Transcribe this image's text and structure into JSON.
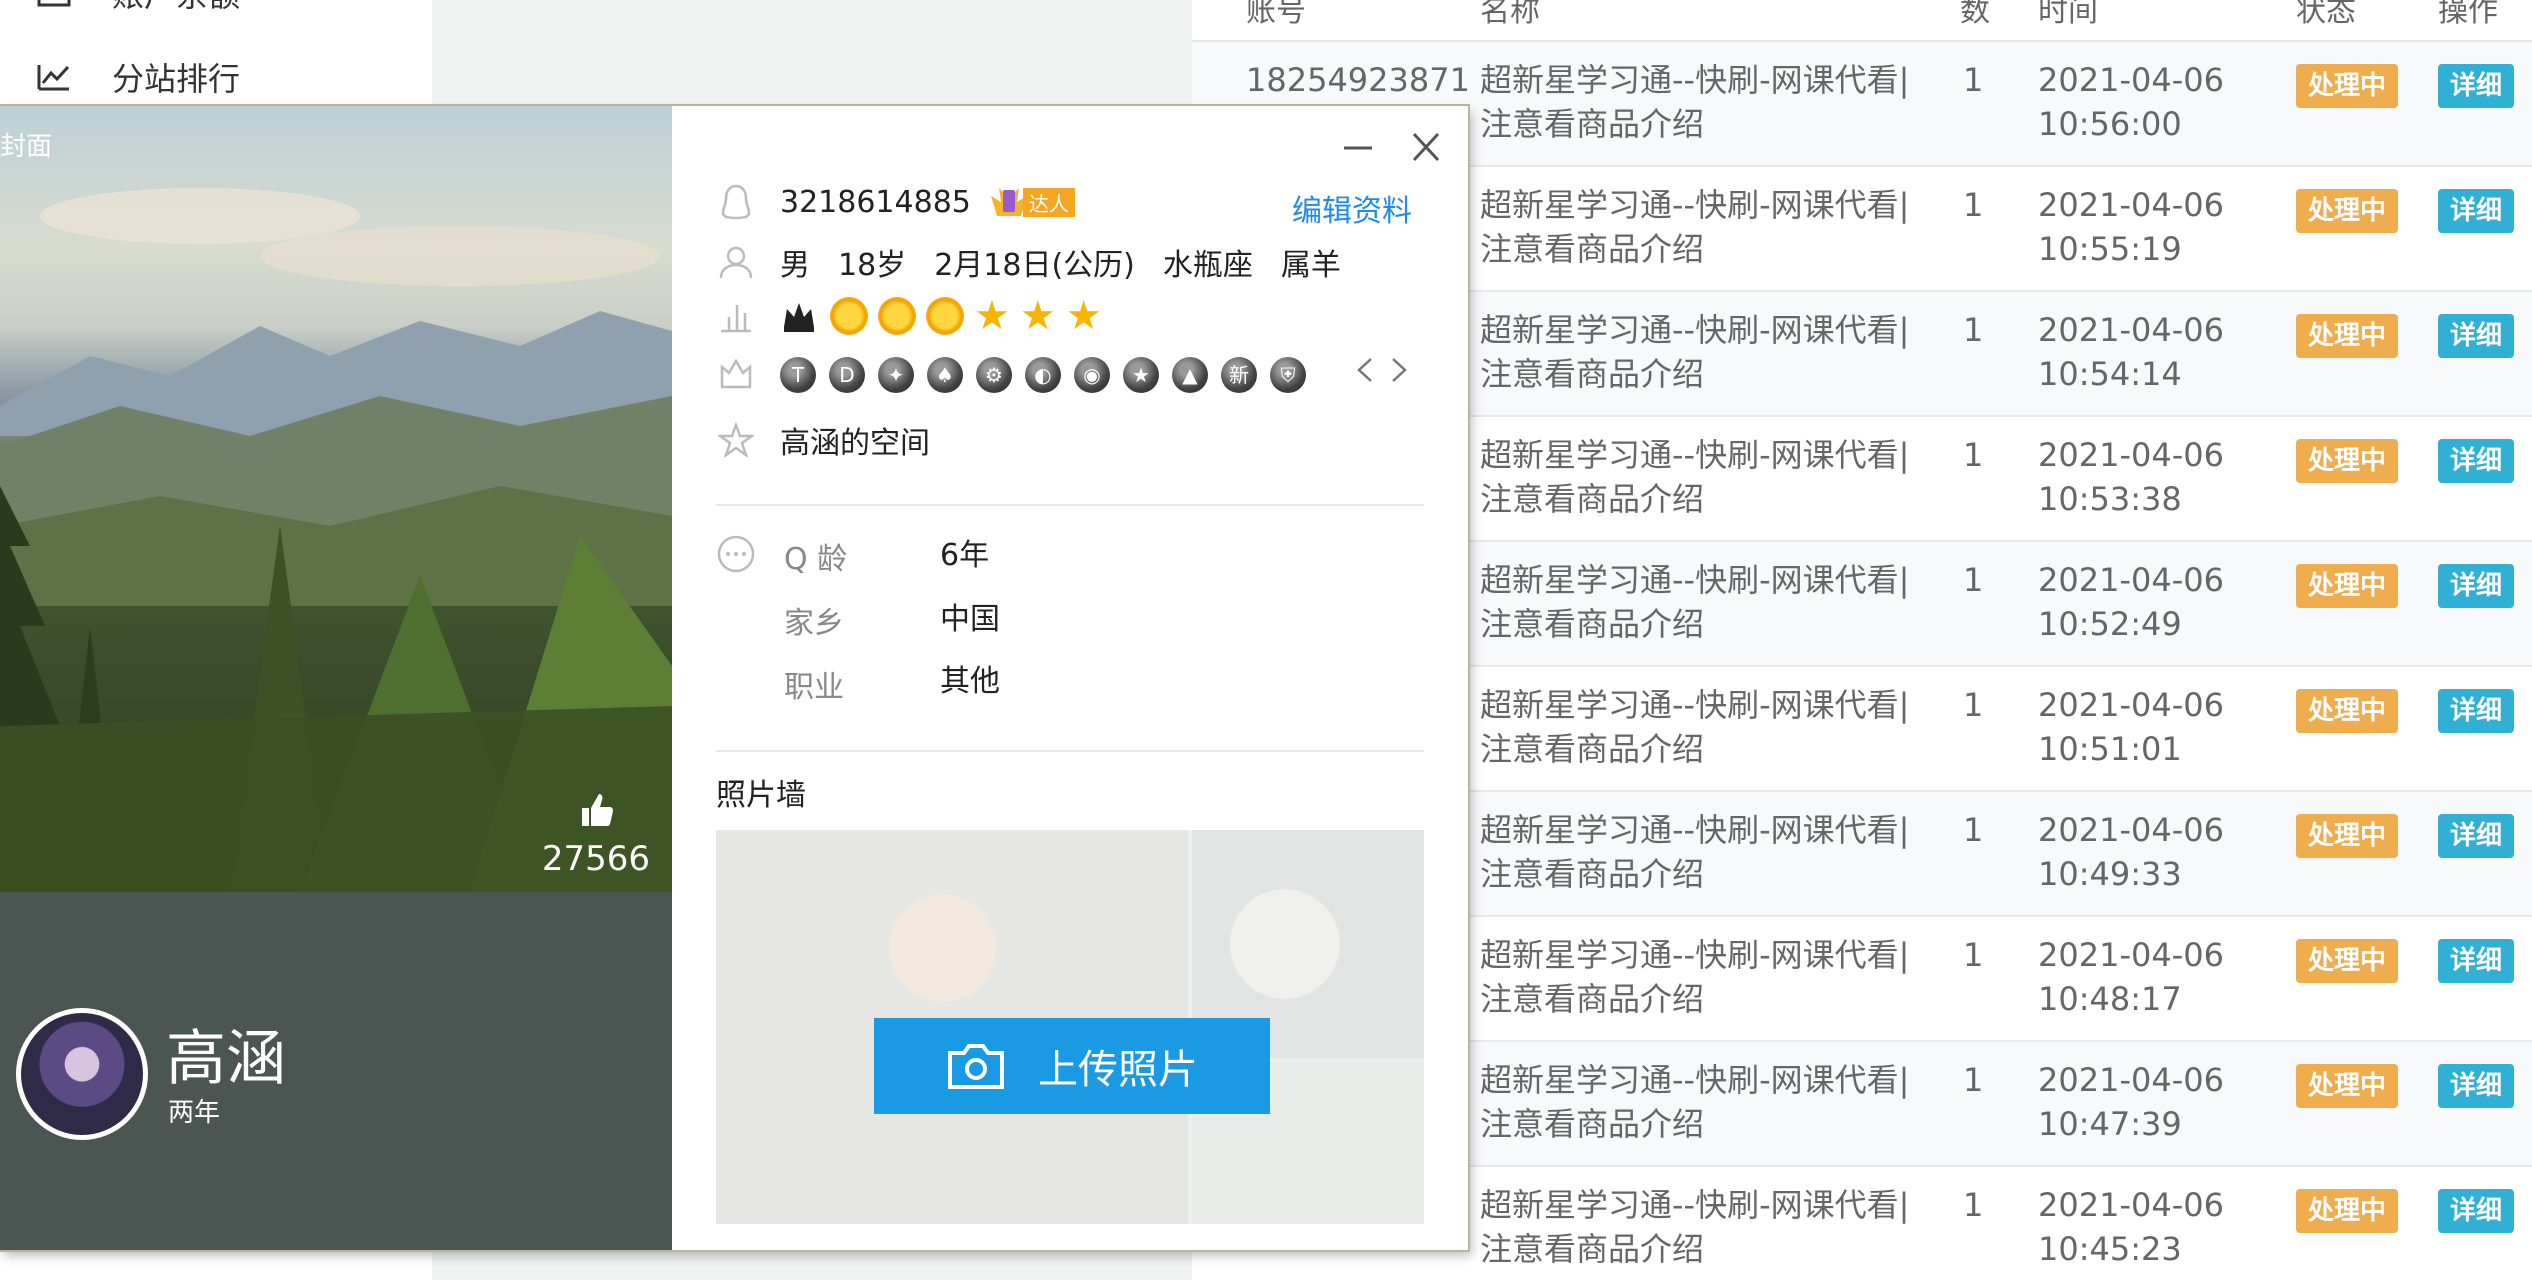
{
  "sidebar": {
    "items": [
      {
        "label": "账户余额",
        "icon": "wallet-icon"
      },
      {
        "label": "分站排行",
        "icon": "chart-line-icon"
      }
    ]
  },
  "orders_table": {
    "headers": [
      "账号",
      "名称",
      "数",
      "时间",
      "状态",
      "操作"
    ],
    "rows": [
      {
        "account": "18254923871",
        "name": "超新星学习通--快刷-网课代看|注意看商品介绍",
        "qty": "1",
        "date": "2021-04-06",
        "time": "10:56:00",
        "status": "处理中",
        "action": "详细"
      },
      {
        "account": "",
        "name": "超新星学习通--快刷-网课代看|注意看商品介绍",
        "qty": "1",
        "date": "2021-04-06",
        "time": "10:55:19",
        "status": "处理中",
        "action": "详细"
      },
      {
        "account": "",
        "name": "超新星学习通--快刷-网课代看|注意看商品介绍",
        "qty": "1",
        "date": "2021-04-06",
        "time": "10:54:14",
        "status": "处理中",
        "action": "详细"
      },
      {
        "account": "",
        "name": "超新星学习通--快刷-网课代看|注意看商品介绍",
        "qty": "1",
        "date": "2021-04-06",
        "time": "10:53:38",
        "status": "处理中",
        "action": "详细"
      },
      {
        "account": "",
        "name": "超新星学习通--快刷-网课代看|注意看商品介绍",
        "qty": "1",
        "date": "2021-04-06",
        "time": "10:52:49",
        "status": "处理中",
        "action": "详细"
      },
      {
        "account": "",
        "name": "超新星学习通--快刷-网课代看|注意看商品介绍",
        "qty": "1",
        "date": "2021-04-06",
        "time": "10:51:01",
        "status": "处理中",
        "action": "详细"
      },
      {
        "account": "",
        "name": "超新星学习通--快刷-网课代看|注意看商品介绍",
        "qty": "1",
        "date": "2021-04-06",
        "time": "10:49:33",
        "status": "处理中",
        "action": "详细"
      },
      {
        "account": "",
        "name": "超新星学习通--快刷-网课代看|注意看商品介绍",
        "qty": "1",
        "date": "2021-04-06",
        "time": "10:48:17",
        "status": "处理中",
        "action": "详细"
      },
      {
        "account": "",
        "name": "超新星学习通--快刷-网课代看|注意看商品介绍",
        "qty": "1",
        "date": "2021-04-06",
        "time": "10:47:39",
        "status": "处理中",
        "action": "详细"
      },
      {
        "account": "",
        "name": "超新星学习通--快刷-网课代看|注意看商品介绍",
        "qty": "1",
        "date": "2021-04-06",
        "time": "10:45:23",
        "status": "处理中",
        "action": "详细"
      }
    ],
    "colors": {
      "status": "#f0ad4e",
      "detail": "#31b0d5"
    }
  },
  "profile_card": {
    "cover_label": "封面",
    "likes": "27566",
    "nickname": "高涵",
    "subtext": "两年",
    "qq_number": "3218614885",
    "badge_text": "达人",
    "edit_label": "编辑资料",
    "personal": {
      "gender": "男",
      "age": "18岁",
      "birthday": "2月18日(公历)",
      "zodiac": "水瓶座",
      "animal": "属羊"
    },
    "level_icons": [
      "crown-icon",
      "sun-icon",
      "sun-icon",
      "sun-icon",
      "star-icon",
      "star-icon",
      "star-icon"
    ],
    "medal_count": 11,
    "space_name": "高涵的空间",
    "details": [
      {
        "label": "Q 龄",
        "value": "6年"
      },
      {
        "label": "家乡",
        "value": "中国"
      },
      {
        "label": "职业",
        "value": "其他"
      }
    ],
    "photo_wall_title": "照片墙",
    "upload_label": "上传照片",
    "accent": "#1a9ae3",
    "link_color": "#1e8ce6"
  }
}
